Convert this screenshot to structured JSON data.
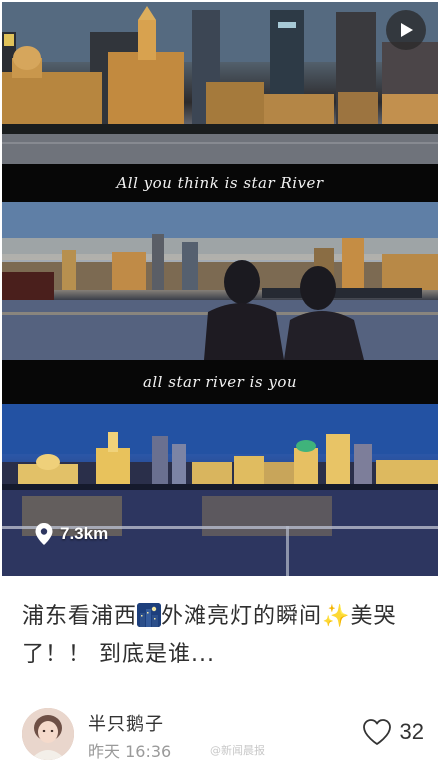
{
  "post": {
    "captions": [
      "All you think is star River",
      "all star river is you"
    ],
    "distance": "7.3km",
    "title_part1": "浦东看浦西",
    "title_part2": "外滩亮灯的瞬间",
    "title_part3": "美哭了！！ 到底是谁...",
    "icons": {
      "play": "play-icon",
      "location": "location-pin-icon",
      "city_emoji": "night-city-emoji",
      "sparkle_emoji": "sparkles-emoji",
      "heart": "heart-outline-icon"
    }
  },
  "author": {
    "name": "半只鹅子",
    "timestamp": "昨天 16:36",
    "watermark": "@新闻晨报"
  },
  "stats": {
    "likes": "32"
  },
  "colors": {
    "accent": "#f3c21b",
    "text": "#2f2f2f",
    "muted": "#9a9a9a"
  }
}
